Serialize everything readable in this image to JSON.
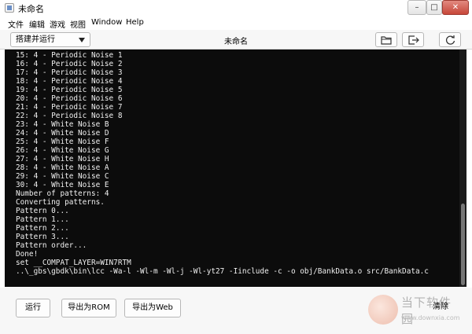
{
  "window": {
    "title": "未命名",
    "minimize": "–",
    "maximize": "□",
    "close": "✕"
  },
  "menu": [
    "文件",
    "编辑",
    "游戏",
    "视图",
    "Window",
    "Help"
  ],
  "toolbar": {
    "build_mode": "搭建并运行",
    "project_name": "未命名",
    "buttons": [
      {
        "name": "folder-icon"
      },
      {
        "name": "export-icon"
      },
      {
        "name": "refresh-icon"
      }
    ]
  },
  "console": {
    "lines": [
      "15: 4 - Periodic Noise 1",
      "16: 4 - Periodic Noise 2",
      "17: 4 - Periodic Noise 3",
      "18: 4 - Periodic Noise 4",
      "19: 4 - Periodic Noise 5",
      "20: 4 - Periodic Noise 6",
      "21: 4 - Periodic Noise 7",
      "22: 4 - Periodic Noise 8",
      "23: 4 - White Noise B",
      "24: 4 - White Noise D",
      "25: 4 - White Noise F",
      "26: 4 - White Noise G",
      "27: 4 - White Noise H",
      "28: 4 - White Noise A",
      "29: 4 - White Noise C",
      "30: 4 - White Noise E",
      "Number of patterns: 4",
      "Converting patterns.",
      "Pattern 0...",
      "Pattern 1...",
      "Pattern 2...",
      "Pattern 3...",
      "Pattern order...",
      "Done!",
      "set __COMPAT_LAYER=WIN7RTM",
      "..\\_gbs\\gbdk\\bin\\lcc -Wa-l -Wl-m -Wl-j -Wl-yt27 -Iinclude -c -o obj/BankData.o src/BankData.c"
    ]
  },
  "footer": {
    "run": "运行",
    "export_rom": "导出为ROM",
    "export_web": "导出为Web",
    "clear": "清除"
  },
  "watermark": {
    "text": "当下软件园",
    "url": "www.downxia.com"
  }
}
